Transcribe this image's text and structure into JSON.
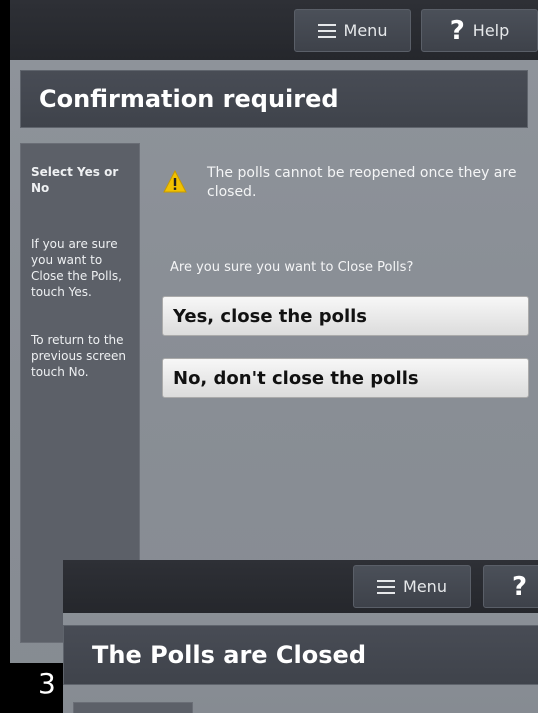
{
  "back_screen": {
    "topbar": {
      "menu_label": "Menu",
      "help_label": "Help"
    },
    "title": "Confirmation required",
    "sidebar": {
      "title": "Select Yes or No",
      "instructions": [
        "If you are sure you want to Close the Polls, touch Yes.",
        "To return to the previous screen touch No."
      ]
    },
    "warning": {
      "icon": "warning-triangle-icon",
      "message": "The polls cannot be reopened once they are closed."
    },
    "question": "Are you sure you want to Close Polls?",
    "buttons": {
      "yes": "Yes, close the polls",
      "no": "No, don't close the polls"
    }
  },
  "front_screen": {
    "topbar": {
      "menu_label": "Menu",
      "help_label": "?"
    },
    "title": "The Polls are Closed"
  },
  "step_number": "3",
  "colors": {
    "topbar": "#2a2c31",
    "panel": "#8a8f96",
    "warning_yellow": "#f2c200"
  }
}
